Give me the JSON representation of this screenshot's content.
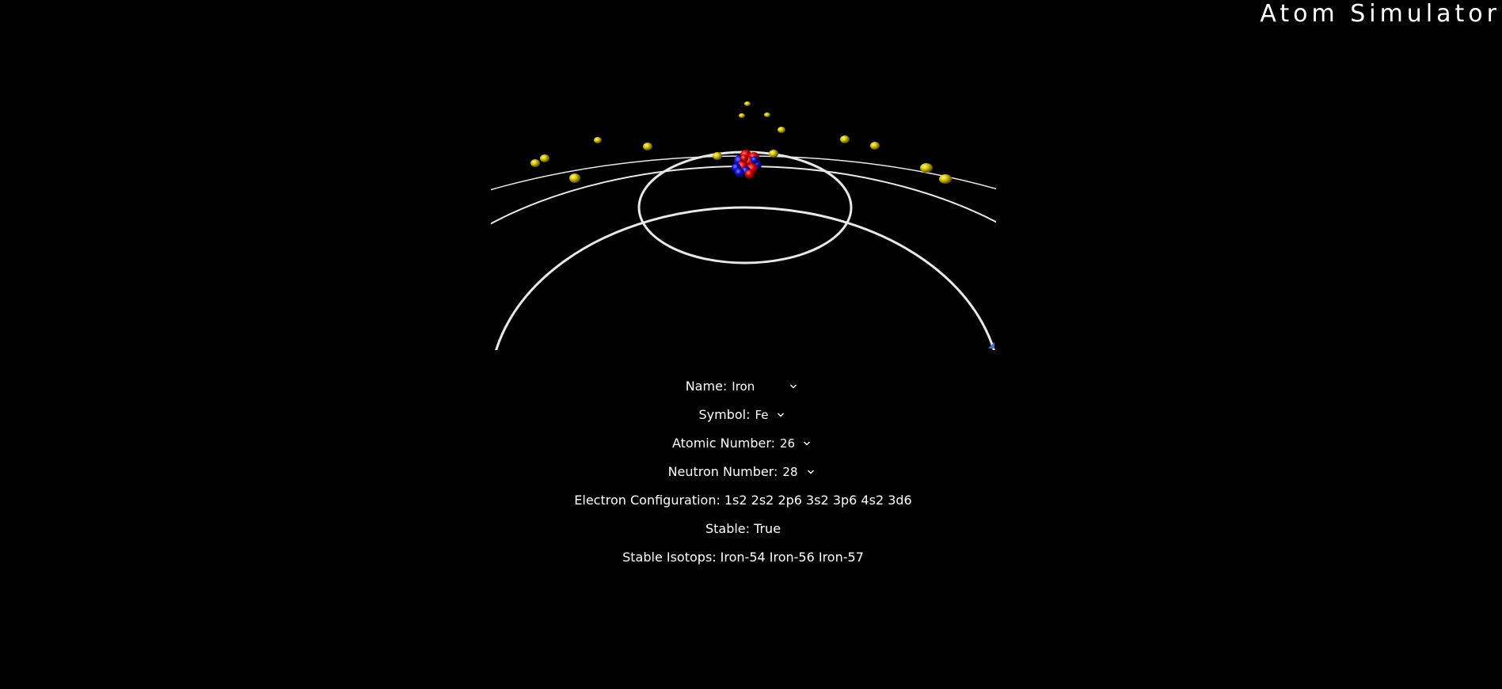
{
  "app": {
    "title": "Atom Simulator"
  },
  "viewport": {
    "nucleus": {
      "protons": 26,
      "neutrons": 28,
      "proton_color": "#e00000",
      "neutron_color": "#1010d0"
    },
    "electron_color": "#c9b800",
    "orbit_color": "#e8e8e8",
    "shells": [
      2,
      8,
      14,
      2
    ]
  },
  "info": {
    "name": {
      "label": "Name:",
      "value": "Iron"
    },
    "symbol": {
      "label": "Symbol:",
      "value": "Fe"
    },
    "atomic_number": {
      "label": "Atomic Number:",
      "value": "26"
    },
    "neutron_number": {
      "label": "Neutron Number:",
      "value": "28"
    },
    "electron_configuration": {
      "label": "Electron Configuration:",
      "value": "1s2 2s2 2p6 3s2 3p6 4s2 3d6"
    },
    "stable": {
      "label": "Stable:",
      "value": "True"
    },
    "stable_isotopes": {
      "label": "Stable Isotops:",
      "value": "Iron-54 Iron-56 Iron-57"
    }
  }
}
